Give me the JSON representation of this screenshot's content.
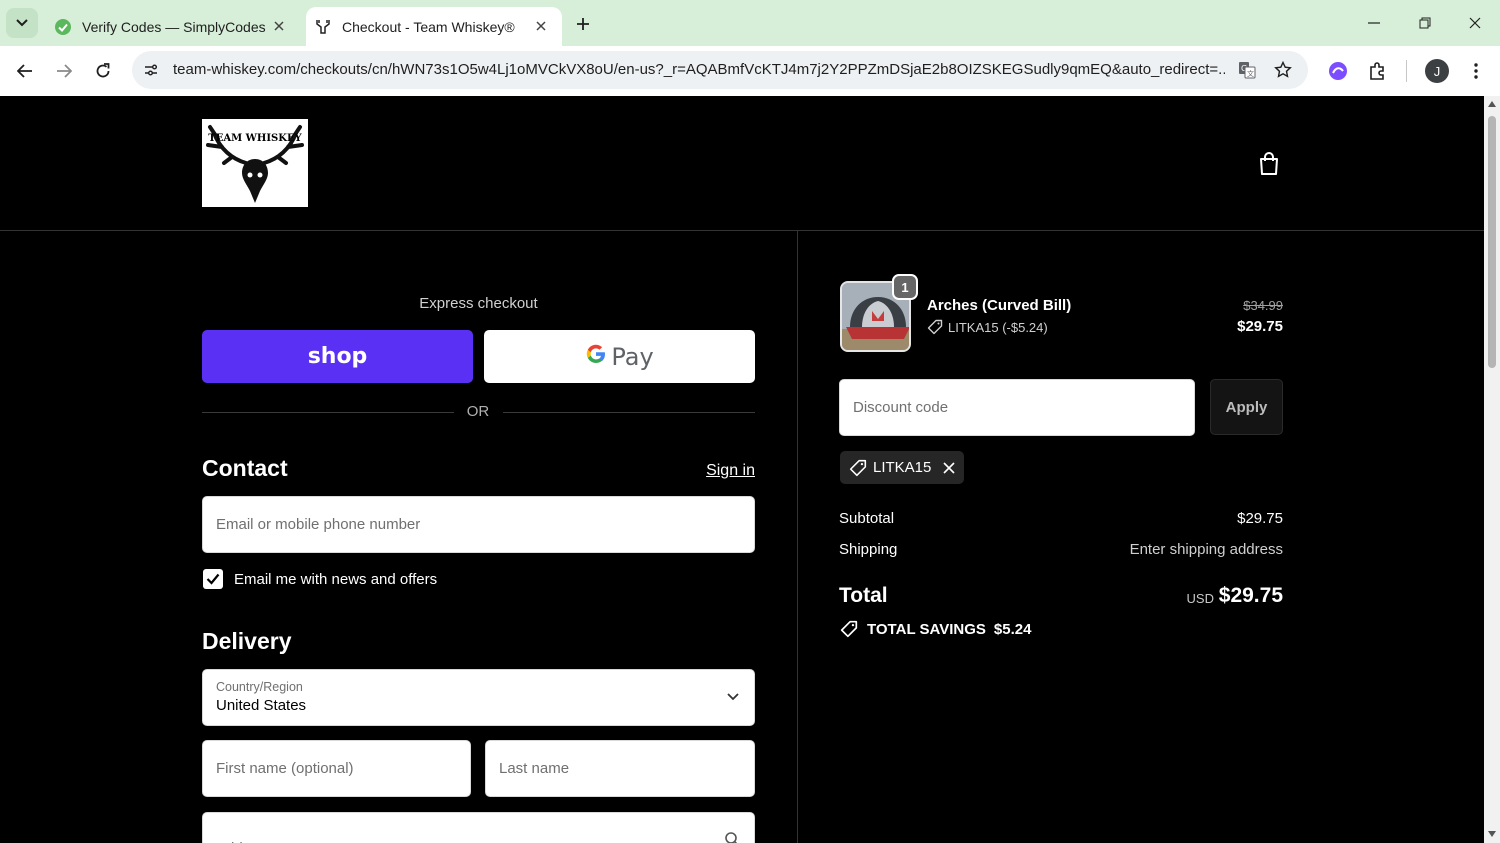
{
  "browser": {
    "tabs": [
      {
        "title": "Verify Codes — SimplyCodes",
        "active": false,
        "favicon": "simplycodes-icon"
      },
      {
        "title": "Checkout - Team Whiskey®",
        "active": true,
        "favicon": "antlers-icon"
      }
    ],
    "url": "team-whiskey.com/checkouts/cn/hWN73s1O5w4Lj1oMVCkVX8oU/en-us?_r=AQABmfVcKTJ4m7j2Y2PPZmDSjaE2b8OIZSKEGSudly9qmEQ&auto_redirect=...",
    "profile_initial": "J"
  },
  "store": {
    "logo_text": "TEAM WHISKEY"
  },
  "checkout": {
    "express_label": "Express checkout",
    "shop_label": "shop",
    "gpay_label": "Pay",
    "or_label": "OR",
    "contact": {
      "heading": "Contact",
      "sign_in": "Sign in",
      "email_placeholder": "Email or mobile phone number",
      "newsletter_label": "Email me with news and offers",
      "newsletter_checked": true
    },
    "delivery": {
      "heading": "Delivery",
      "country_label": "Country/Region",
      "country_value": "United States",
      "first_name_placeholder": "First name (optional)",
      "last_name_placeholder": "Last name",
      "address_placeholder": "Address"
    }
  },
  "summary": {
    "item": {
      "name": "Arches (Curved Bill)",
      "quantity": "1",
      "discount": "LITKA15 (-$5.24)",
      "original_price": "$34.99",
      "price": "$29.75"
    },
    "discount_placeholder": "Discount code",
    "apply_label": "Apply",
    "applied_code": "LITKA15",
    "subtotal_label": "Subtotal",
    "subtotal_value": "$29.75",
    "shipping_label": "Shipping",
    "shipping_value": "Enter shipping address",
    "total_label": "Total",
    "total_currency": "USD",
    "total_value": "$29.75",
    "savings_label": "TOTAL SAVINGS",
    "savings_value": "$5.24"
  },
  "colors": {
    "shop_pay_purple": "#5a31f4",
    "page_bg": "#000000",
    "chrome_tab_bg": "#d7eed8"
  }
}
